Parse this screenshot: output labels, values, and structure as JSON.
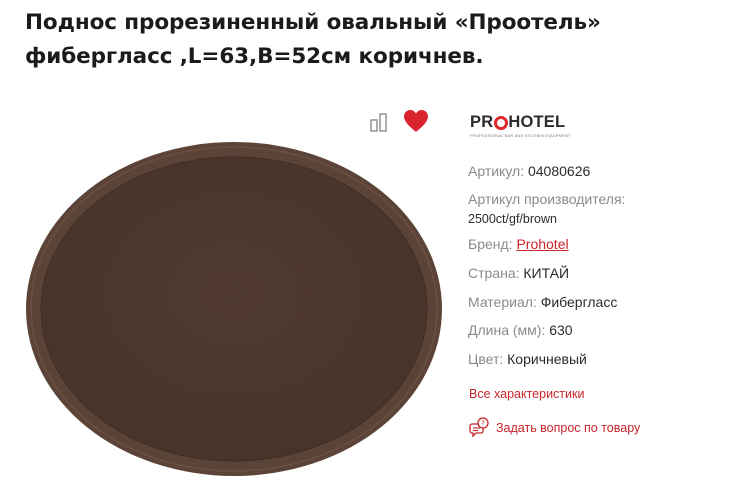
{
  "product": {
    "title_line1": "Поднос прорезиненный овальный «Проотель»",
    "title_line2": "фибергласс ,L=63,B=52см коричнев.",
    "tray_color": "#4f3a2f",
    "tray_rim_color": "#5c4538"
  },
  "actions": {
    "compare_icon": "bar-chart-icon",
    "favorite_icon": "heart-icon",
    "favorite_color": "#d9232d"
  },
  "brand_logo": {
    "text_before": "PR",
    "text_after": "HOTEL",
    "tagline": "PROFESSIONAL BAR AND KITCHEN EQUIPMENT"
  },
  "specs": {
    "article_label": "Артикул:",
    "article_value": "04080626",
    "mfr_article_label": "Артикул производителя:",
    "mfr_article_value": "2500ct/gf/brown",
    "brand_label": "Бренд:",
    "brand_value": "Prohotel",
    "country_label": "Страна:",
    "country_value": "КИТАЙ",
    "material_label": "Материал:",
    "material_value": "Фибергласс",
    "length_label": "Длина (мм):",
    "length_value": "630",
    "color_label": "Цвет:",
    "color_value": "Коричневый"
  },
  "links": {
    "all_characteristics": "Все характеристики",
    "ask_question": "Задать вопрос по товару",
    "ask_icon": "chat-question-icon"
  }
}
